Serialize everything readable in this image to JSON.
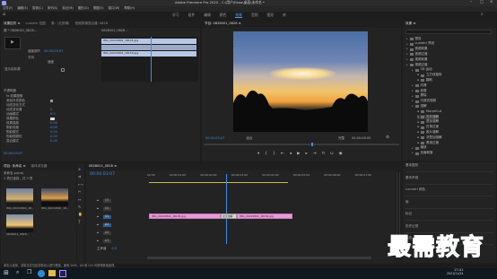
{
  "window": {
    "title": "Adobe Premiere Pro 2020 - C:\\用户\\Ekao\\桌面\\未命名 *"
  },
  "menu": [
    "文件(F)",
    "编辑(E)",
    "剪辑(C)",
    "序列(S)",
    "标记(M)",
    "图形(G)",
    "视图(V)",
    "窗口(W)",
    "帮助(H)"
  ],
  "workspaces": [
    "学习",
    "组件",
    "编辑",
    "颜色",
    "效果",
    "音频",
    "图形",
    "库"
  ],
  "workspace_active": "效果",
  "effect_controls": {
    "tabs": [
      "效果控件 ≡",
      "Lumetri 范围",
      "源：(无剪辑)",
      "音频剪辑混合器: 0828"
    ],
    "source_label": "源 * 0828001_0828...",
    "seq_label": "0828001_0828...",
    "mini_clip_1": "IMG_20210801_18145.jpg",
    "mini_clip_2": "IMG_20210801_18150.jpg",
    "fx_group": "不透明度",
    "labels": [
      "速度调节",
      "方向",
      "速度"
    ],
    "transition": "交叉溶解",
    "align_label": "显示实际源",
    "params": [
      {
        "name": "fx 效果图像",
        "value": ""
      },
      {
        "name": "添加补充颜色",
        "value": ""
      },
      {
        "name": "动态变化方式",
        "value": ""
      },
      {
        "name": "动态变化器",
        "value": "0"
      },
      {
        "name": "动画模式",
        "value": "0.0"
      },
      {
        "name": "效果颜色",
        "value": ""
      },
      {
        "name": "效果强度",
        "value": "0.00"
      },
      {
        "name": "阴影亮度",
        "value": "0.00"
      },
      {
        "name": "阴影模式",
        "value": "0.00"
      },
      {
        "name": "伤痕视频化",
        "value": "0.00"
      },
      {
        "name": "混合模式",
        "value": "0.00"
      }
    ],
    "timecode": "00:00:03:07"
  },
  "program_monitor": {
    "title": "节目: 0828001_0828 ≡",
    "timecode": "00:00:03:07",
    "fit": "适合",
    "quality": "完整",
    "duration": "00:00:06:00"
  },
  "effects_panel": {
    "title": "效果 ≡",
    "items": [
      {
        "label": "预设",
        "indent": 0
      },
      {
        "label": "Lumetri 预设",
        "indent": 0
      },
      {
        "label": "音频效果",
        "indent": 0
      },
      {
        "label": "音频过渡",
        "indent": 0
      },
      {
        "label": "视频效果",
        "indent": 0
      },
      {
        "label": "视频过渡",
        "indent": 0
      },
      {
        "label": "3D 运动",
        "indent": 1
      },
      {
        "label": "立方体旋转",
        "indent": 2
      },
      {
        "label": "翻转",
        "indent": 2
      },
      {
        "label": "内滑",
        "indent": 1
      },
      {
        "label": "划像",
        "indent": 1
      },
      {
        "label": "擦除",
        "indent": 1
      },
      {
        "label": "沉浸式视频",
        "indent": 1
      },
      {
        "label": "溶解",
        "indent": 1
      },
      {
        "label": "MorphCut",
        "indent": 2
      },
      {
        "label": "交叉溶解",
        "indent": 2
      },
      {
        "label": "叠加溶解",
        "indent": 2
      },
      {
        "label": "白场过渡",
        "indent": 2
      },
      {
        "label": "胶片溶解",
        "indent": 2
      },
      {
        "label": "非叠加溶解",
        "indent": 2
      },
      {
        "label": "黑场过渡",
        "indent": 2
      },
      {
        "label": "缩放",
        "indent": 1
      },
      {
        "label": "页面剥落",
        "indent": 1
      }
    ],
    "lower_sections": [
      "基本图形",
      "基本声音",
      "Lumetri 颜色",
      "库",
      "标记",
      "历史记录",
      "信息"
    ]
  },
  "project_panel": {
    "tabs": [
      "项目: 未命名 ≡",
      "媒体浏览器"
    ],
    "path": "未命名.prproj",
    "count": "1 项已选择，共 3 项",
    "thumbs": [
      "IMG_20210801_18...",
      "IMG_20210801_18...",
      "0828001_0828..."
    ]
  },
  "timeline": {
    "tab": "0828001_0828 ≡",
    "timecode": "00:00:03:07",
    "ruler": [
      "00:00",
      "00:00:01:00",
      "00:00:02:00",
      "00:00:03:00",
      "00:00:04:00",
      "00:00:05:00",
      "00:00:06:00",
      "00:00:07:00"
    ],
    "tracks": [
      "V3",
      "V2",
      "V1",
      "A1",
      "A2",
      "A3"
    ],
    "master": "主声道",
    "master_value": "0.0",
    "clip1": "IMG_20210801_18145.jpg",
    "transition": "交叉溶解",
    "clip2": "IMG_20210801_18150.jpg"
  },
  "status": "单击以选择，或单击空白处并拖动以进行框选。使用 Shift、Alt 和 Ctrl 可获得其他选项。",
  "taskbar": {
    "time": "17:41",
    "date": "2021/11/24"
  },
  "watermark": "最需教育"
}
